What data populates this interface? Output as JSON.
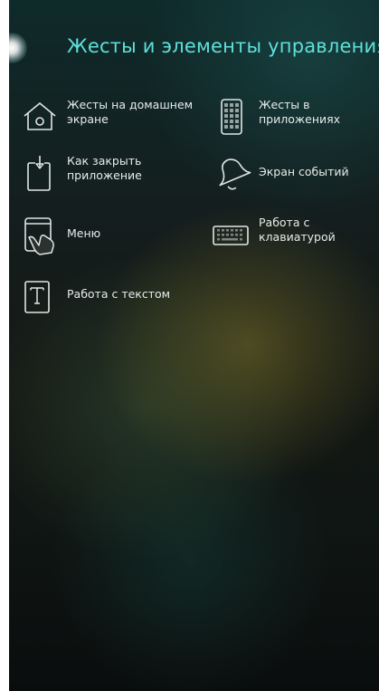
{
  "header": {
    "title": "Жесты и элементы управления"
  },
  "menu": {
    "items": [
      {
        "label": "Жесты на домашнем\nэкране",
        "icon": "home-icon"
      },
      {
        "label": "Жесты в\nприложениях",
        "icon": "app-grid-icon"
      },
      {
        "label": "Как закрыть\nприложение",
        "icon": "close-app-icon"
      },
      {
        "label": "Экран событий",
        "icon": "bell-icon"
      },
      {
        "label": "Меню",
        "icon": "hand-tap-icon"
      },
      {
        "label": "Работа с\nклавиатурой",
        "icon": "keyboard-icon"
      },
      {
        "label": "Работа с текстом",
        "icon": "text-icon"
      }
    ]
  },
  "colors": {
    "title": "#5fe0da",
    "label": "#e6eceb",
    "icon_stroke": "#dfe6e5"
  }
}
